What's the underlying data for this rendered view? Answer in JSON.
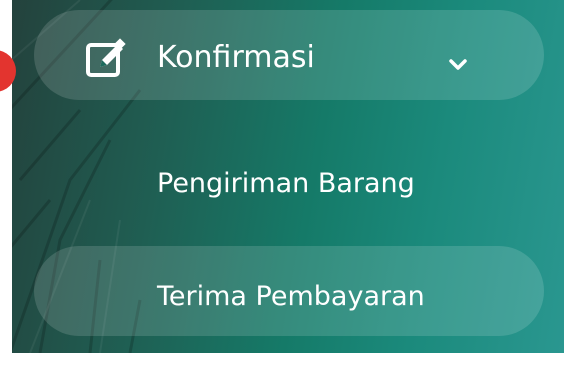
{
  "menu": {
    "parent": {
      "label": "Konfirmasi",
      "icon": "edit-icon",
      "chevron": "chevron-down-icon",
      "expanded": true
    },
    "items": [
      {
        "label": "Pengiriman Barang"
      },
      {
        "label": "Terima Pembayaran"
      }
    ]
  },
  "colors": {
    "accent_red": "#e3342f",
    "text": "#ffffff",
    "sidebar_green": "#157a68"
  }
}
